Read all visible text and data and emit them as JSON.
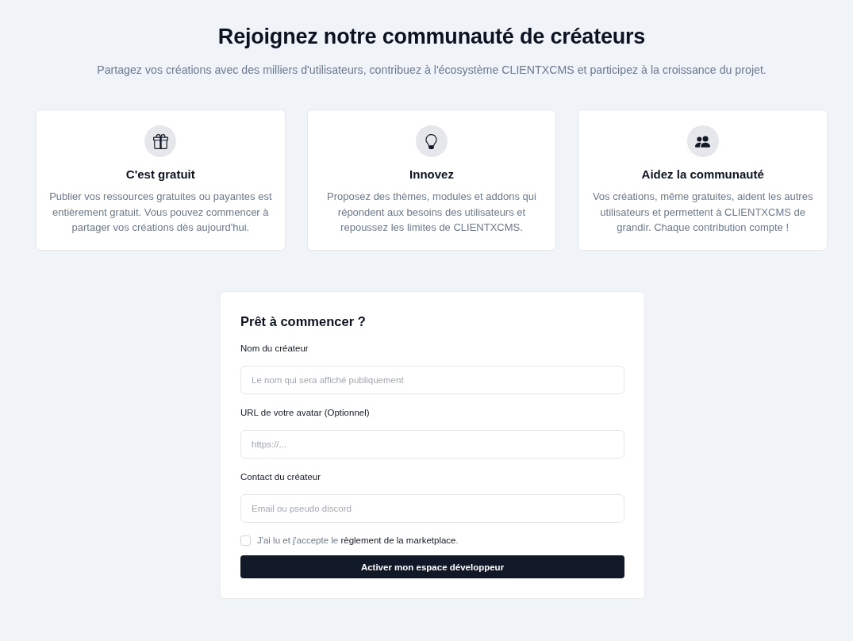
{
  "header": {
    "title": "Rejoignez notre communauté de créateurs",
    "subtitle": "Partagez vos créations avec des milliers d'utilisateurs, contribuez à l'écosystème CLIENTXCMS et participez à la croissance du projet."
  },
  "features": [
    {
      "title": "C'est gratuit",
      "description": "Publier vos ressources gratuites ou payantes est entièrement gratuit. Vous pouvez commencer à partager vos créations dès aujourd'hui."
    },
    {
      "title": "Innovez",
      "description": "Proposez des thèmes, modules et addons qui répondent aux besoins des utilisateurs et repoussez les limites de CLIENTXCMS."
    },
    {
      "title": "Aidez la communauté",
      "description": "Vos créations, même gratuites, aident les autres utilisateurs et permettent à CLIENTXCMS de grandir. Chaque contribution compte !"
    }
  ],
  "form": {
    "title": "Prêt à commencer ?",
    "fields": [
      {
        "label": "Nom du créateur",
        "placeholder": "Le nom qui sera affiché publiquement"
      },
      {
        "label": "URL de votre avatar (Optionnel)",
        "placeholder": "https://..."
      },
      {
        "label": "Contact du créateur",
        "placeholder": "Email ou pseudo discord"
      }
    ],
    "agreement": {
      "checked": false,
      "text_before": "J'ai lu et j'accepte le",
      "link": "règlement de la marketplace",
      "text_after": "."
    },
    "submit_button": "Activer mon espace développeur"
  }
}
